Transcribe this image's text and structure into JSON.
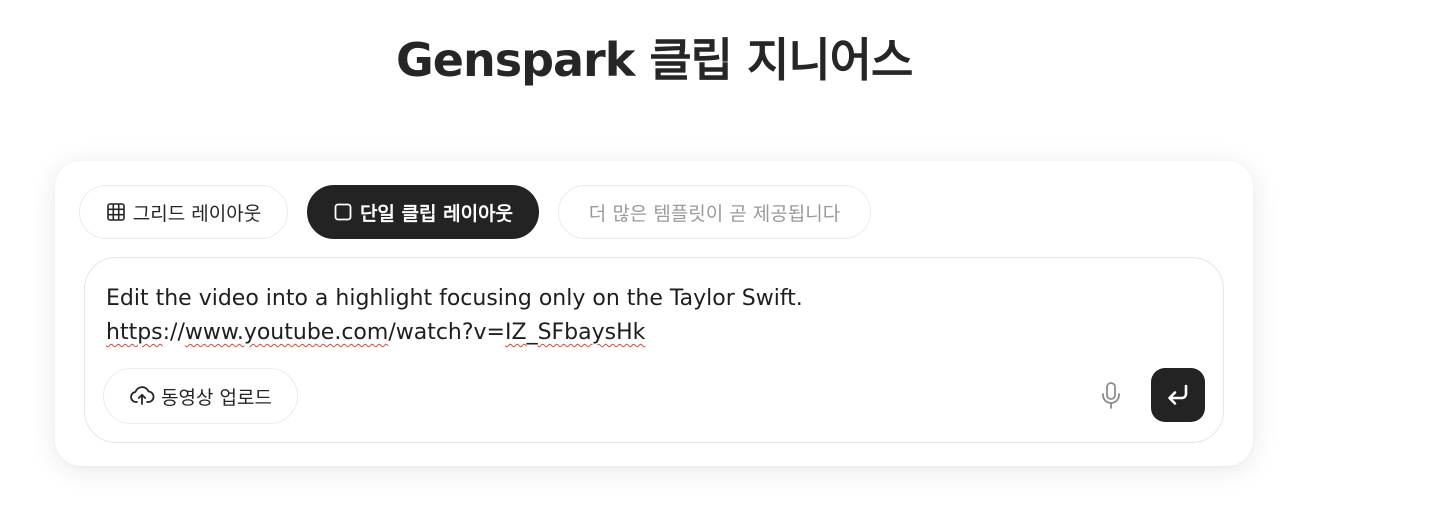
{
  "header": {
    "title": "Genspark 클립 지니어스"
  },
  "layout_tabs": [
    {
      "label": "그리드 레이아웃",
      "icon": "grid-icon",
      "selected": false
    },
    {
      "label": "단일 클립 레이아웃",
      "icon": "square-icon",
      "selected": true
    },
    {
      "label": "더 많은 템플릿이 곧 제공됩니다",
      "icon": "",
      "selected": false,
      "disabled": true
    }
  ],
  "prompt": {
    "line1": "Edit the video into a highlight focusing only on the Taylor Swift.",
    "line2_url_part_a": "https",
    "line2_url_part_b": "://",
    "line2_url_part_c": "www.youtube.com",
    "line2_url_part_d": "/watch?v=",
    "line2_url_part_e": "IZ",
    "line2_url_part_f": "_",
    "line2_url_part_g": "SFbaysHk"
  },
  "actions": {
    "upload_label": "동영상 업로드",
    "upload_icon": "cloud-upload-icon",
    "mic_icon": "microphone-icon",
    "send_icon": "enter-return-icon"
  },
  "colors": {
    "selected_chip_bg": "#232323",
    "send_button_bg": "#232323",
    "spellcheck_underline": "#e0443a",
    "disabled_text": "#9a9a9a"
  }
}
